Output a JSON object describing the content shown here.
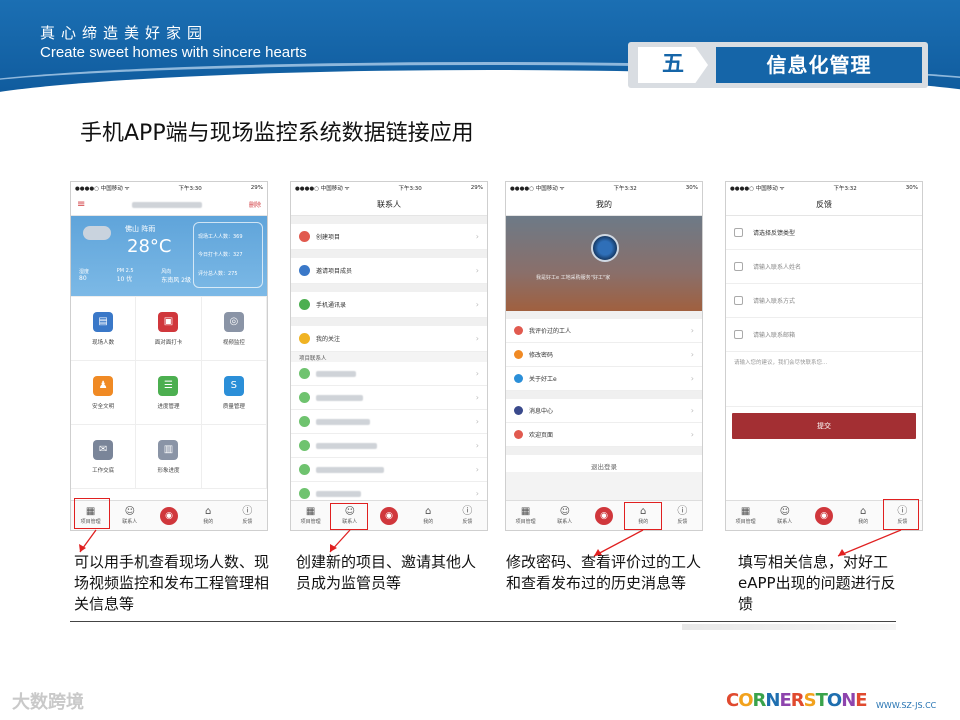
{
  "banner": {
    "slogan_cn": "真心缔造美好家园",
    "slogan_en": "Create sweet homes with sincere hearts",
    "section_num": "五",
    "section_title": "信息化管理"
  },
  "heading": "手机APP端与现场监控系统数据链接应用",
  "status": {
    "carrier": "●●●●○ 中国移动 ᯤ",
    "time1": "下午3:30",
    "time3": "下午3:32",
    "battery1": "29%",
    "battery3": "30%"
  },
  "tabs": {
    "items": [
      {
        "label": "项目管理",
        "icon": "grid-icon",
        "glyph": "▦"
      },
      {
        "label": "联系人",
        "icon": "contacts-icon",
        "glyph": "☺"
      },
      {
        "label": "",
        "icon": "camera-icon",
        "glyph": "◉"
      },
      {
        "label": "我的",
        "icon": "home-icon",
        "glyph": "⌂"
      },
      {
        "label": "反馈",
        "icon": "info-icon",
        "glyph": "ⓘ"
      }
    ]
  },
  "phone1": {
    "menu_glyph": "≡",
    "top_right": "删除",
    "city": "佛山 阵雨",
    "temp": "28°C",
    "stats": [
      "现场工人人数：369",
      "今日打卡人数：327",
      "评分总人数：275"
    ],
    "metrics": [
      {
        "k": "湿度",
        "v": "80"
      },
      {
        "k": "PM 2.5",
        "v": "10 优"
      },
      {
        "k": "风向",
        "v": "东南风 2级"
      }
    ],
    "grid": [
      {
        "label": "现场人数",
        "icon": "calendar-icon",
        "color": "#3a78c8",
        "glyph": "▤"
      },
      {
        "label": "面对面打卡",
        "icon": "qr-code-icon",
        "color": "#d0373c",
        "glyph": "▣"
      },
      {
        "label": "视频监控",
        "icon": "camera-monitor-icon",
        "color": "#8a94a6",
        "glyph": "◎"
      },
      {
        "label": "安全文明",
        "icon": "worker-helmet-icon",
        "color": "#f08a24",
        "glyph": "♟"
      },
      {
        "label": "进度管理",
        "icon": "progress-bars-icon",
        "color": "#4caf50",
        "glyph": "☰"
      },
      {
        "label": "质量管理",
        "icon": "quality-s-icon",
        "color": "#2b8fd8",
        "glyph": "S"
      },
      {
        "label": "工作交底",
        "icon": "envelope-icon",
        "color": "#7a8599",
        "glyph": "✉"
      },
      {
        "label": "形象进度",
        "icon": "building-icon",
        "color": "#8a94a6",
        "glyph": "▥"
      }
    ]
  },
  "phone2": {
    "title": "联系人",
    "rows": [
      {
        "label": "创建项目",
        "color": "#e15a4f"
      },
      {
        "label": "邀请项目成员",
        "color": "#3a78c8"
      },
      {
        "label": "手机通讯录",
        "color": "#4caf50"
      },
      {
        "label": "我的关注",
        "color": "#f0b323"
      }
    ],
    "section": "项目联系人"
  },
  "phone3": {
    "title": "我的",
    "avatar_caption": "我是好工e 工地采购服务\"好工\"家",
    "rows": [
      {
        "label": "我评价过的工人",
        "color": "#e15a4f"
      },
      {
        "label": "修改密码",
        "color": "#f08a24"
      },
      {
        "label": "关于好工e",
        "color": "#2b8fd8"
      },
      {
        "label": "消息中心",
        "color": "#3a4a8c"
      },
      {
        "label": "欢迎页面",
        "color": "#e15a4f"
      }
    ],
    "logout": "退出登录"
  },
  "phone4": {
    "title": "反馈",
    "type_label": "请选择反馈类型",
    "fields": [
      "请输入联系人姓名",
      "请输入联系方式",
      "请输入联系邮箱"
    ],
    "textarea": "请输入您的建议，我们会尽快联系您...",
    "submit": "提交"
  },
  "captions": [
    "可以用手机查看现场人数、现场视频监控和发布工程管理相关信息等",
    "创建新的项目、邀请其他人员成为监管员等",
    "修改密码、查看评价过的工人和查看发布过的历史消息等",
    "填写相关信息，对好工eAPP出现的问题进行反馈"
  ],
  "footer": {
    "watermark": "大数跨境",
    "logo_text": "CORNERSTONE",
    "logo_sub": "WWW.SZ-JS.CC"
  },
  "colors": {
    "brand_blue": "#1565a8",
    "submit_red": "#a32f33",
    "highlight": "#e02020"
  }
}
